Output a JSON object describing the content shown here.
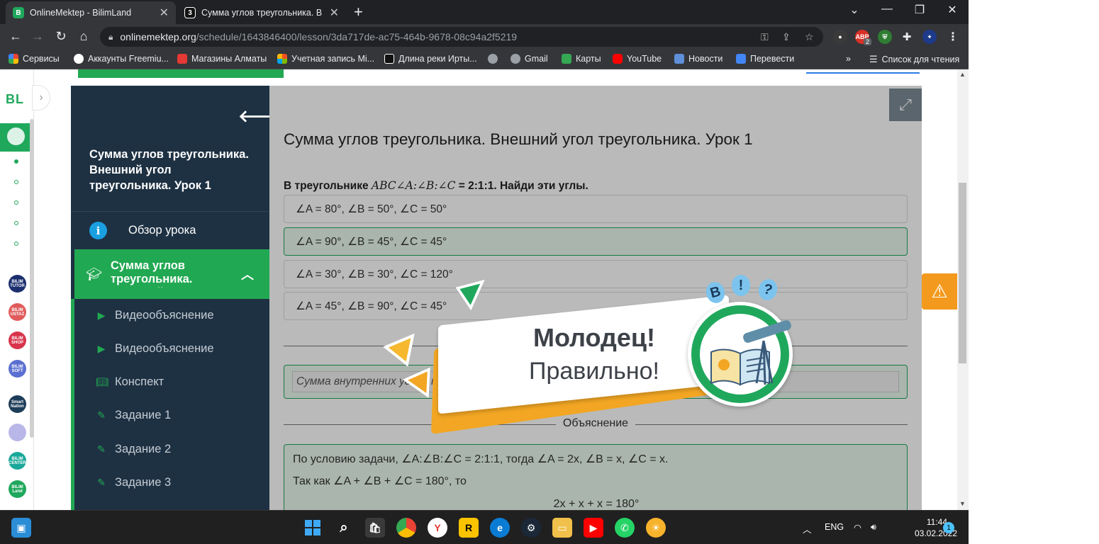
{
  "browser": {
    "tabs": [
      {
        "title": "OnlineMektep - BilimLand",
        "active": true
      },
      {
        "title": "Сумма углов треугольника. Вне",
        "active": false
      }
    ],
    "url_host": "onlinemektep.org",
    "url_path": "/schedule/1643846400/lesson/3da717de-ac75-464b-9678-08c94a2f5219",
    "bookmarks": [
      "Сервисы",
      "Аккаунты Freemiu...",
      "Магазины Алматы",
      "Учетная запись Mi...",
      "Длина реки Ирты...",
      "Gmail",
      "Карты",
      "YouTube",
      "Новости",
      "Перевести"
    ],
    "reading_list": "Список для чтения",
    "ext_badge": "2"
  },
  "rail": {
    "logo": "BL",
    "apps": [
      {
        "label": "BILIM TUTOR",
        "color": "#1b2f6e"
      },
      {
        "label": "BILIM USTAZ",
        "color": "#e05c5c"
      },
      {
        "label": "BILIM SHOP",
        "color": "#d8344b"
      },
      {
        "label": "BILIM SOFT",
        "color": "#5a6fd0"
      },
      {
        "label": "Smart Nation",
        "color": "#1d3c57"
      },
      {
        "label": "",
        "color": "#b9b7e8"
      },
      {
        "label": "BILIM CENTER",
        "color": "#1aa89a"
      },
      {
        "label": "BILIM Land",
        "color": "#1fa85c"
      }
    ]
  },
  "sidebar": {
    "lesson_title": "Сумма углов треугольника. Внешний угол треугольника. Урок 1",
    "overview": "Обзор урока",
    "section": "Сумма углов треугольника. Внешний угол",
    "items": [
      {
        "label": "Видеообъяснение",
        "icon": "play-icon"
      },
      {
        "label": "Видеообъяснение",
        "icon": "play-icon"
      },
      {
        "label": "Конспект",
        "icon": "book-icon"
      },
      {
        "label": "Задание 1",
        "icon": "edit-icon"
      },
      {
        "label": "Задание 2",
        "icon": "edit-icon"
      },
      {
        "label": "Задание 3",
        "icon": "edit-icon"
      }
    ]
  },
  "main": {
    "title": "Сумма углов треугольника. Внешний угол треугольника. Урок 1",
    "question_prefix": "В треугольнике ",
    "question_math": "ABC∠A:∠B:∠C",
    "question_suffix": " = 2:1:1. Найди эти углы.",
    "options": [
      {
        "text": "∠A = 80°, ∠B = 50°, ∠C = 50°",
        "correct": false
      },
      {
        "text": "∠A = 90°, ∠B = 45°, ∠C = 45°",
        "correct": true
      },
      {
        "text": "∠A = 30°, ∠B = 30°, ∠C = 120°",
        "correct": false
      },
      {
        "text": "∠A = 45°, ∠B = 90°, ∠C = 45°",
        "correct": false
      }
    ],
    "answer_text": "Сумма внутренних углов треугольника равна",
    "explanation_heading": "Объяснение",
    "expl_line1": "По условию задачи, ∠A:∠B:∠C = 2:1:1, тогда ∠A = 2x, ∠B = x, ∠C = x.",
    "expl_line2": "Так как ∠A + ∠B + ∠C = 180°, то",
    "expl_line3": "2x + x + x = 180°"
  },
  "popup": {
    "title": "Молодец!",
    "subtitle": "Правильно!"
  },
  "taskbar": {
    "lang": "ENG",
    "time": "11:44",
    "date": "03.02.2022",
    "notifications": "1"
  }
}
